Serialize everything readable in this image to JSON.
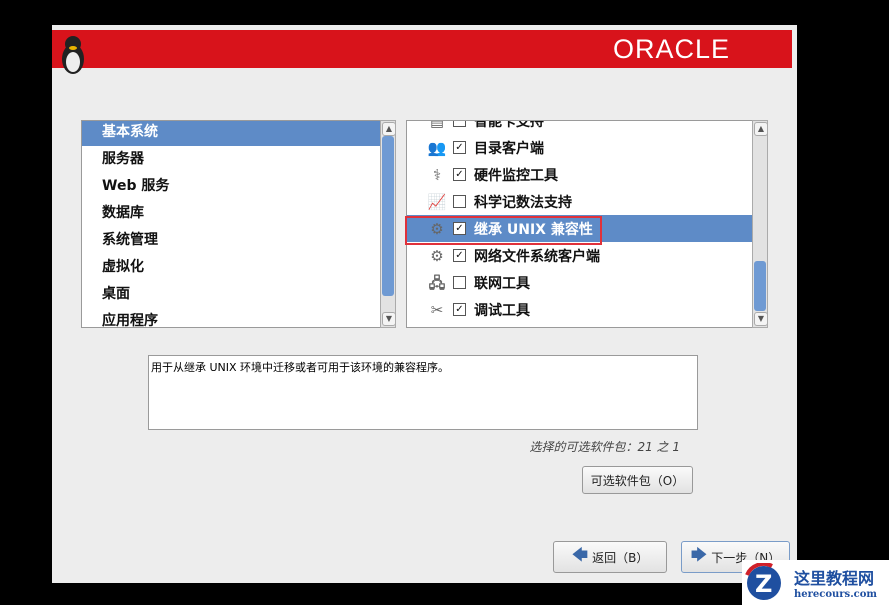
{
  "header": {
    "brand": "ORACLE"
  },
  "groups": [
    "基本系统",
    "服务器",
    "Web 服务",
    "数据库",
    "系统管理",
    "虚拟化",
    "桌面",
    "应用程序"
  ],
  "packages": [
    {
      "label": "智能卡支持",
      "checked": false,
      "icon": "smartcard-icon"
    },
    {
      "label": "目录客户端",
      "checked": true,
      "icon": "directory-users-icon"
    },
    {
      "label": "硬件监控工具",
      "checked": true,
      "icon": "hardware-monitor-icon"
    },
    {
      "label": "科学记数法支持",
      "checked": false,
      "icon": "scientific-monitor-icon"
    },
    {
      "label": "继承 UNIX 兼容性",
      "checked": true,
      "icon": "gear-icon",
      "selected": true
    },
    {
      "label": "网络文件系统客户端",
      "checked": true,
      "icon": "gear-icon"
    },
    {
      "label": "联网工具",
      "checked": false,
      "icon": "network-icon"
    },
    {
      "label": "调试工具",
      "checked": true,
      "icon": "tools-icon"
    }
  ],
  "description": "用于从继承 UNIX 环境中迁移或者可用于该环境的兼容程序。",
  "count": "选择的可选软件包：21 之 1",
  "buttons": {
    "optional": "可选软件包（O）",
    "back": "返回（B）",
    "next": "下一步（N）"
  },
  "watermark": {
    "title": "这里教程网",
    "url": "herecours.com"
  },
  "colors": {
    "header": "#d8131b",
    "selection": "#5e8bc7",
    "highlight": "#e0313a"
  }
}
